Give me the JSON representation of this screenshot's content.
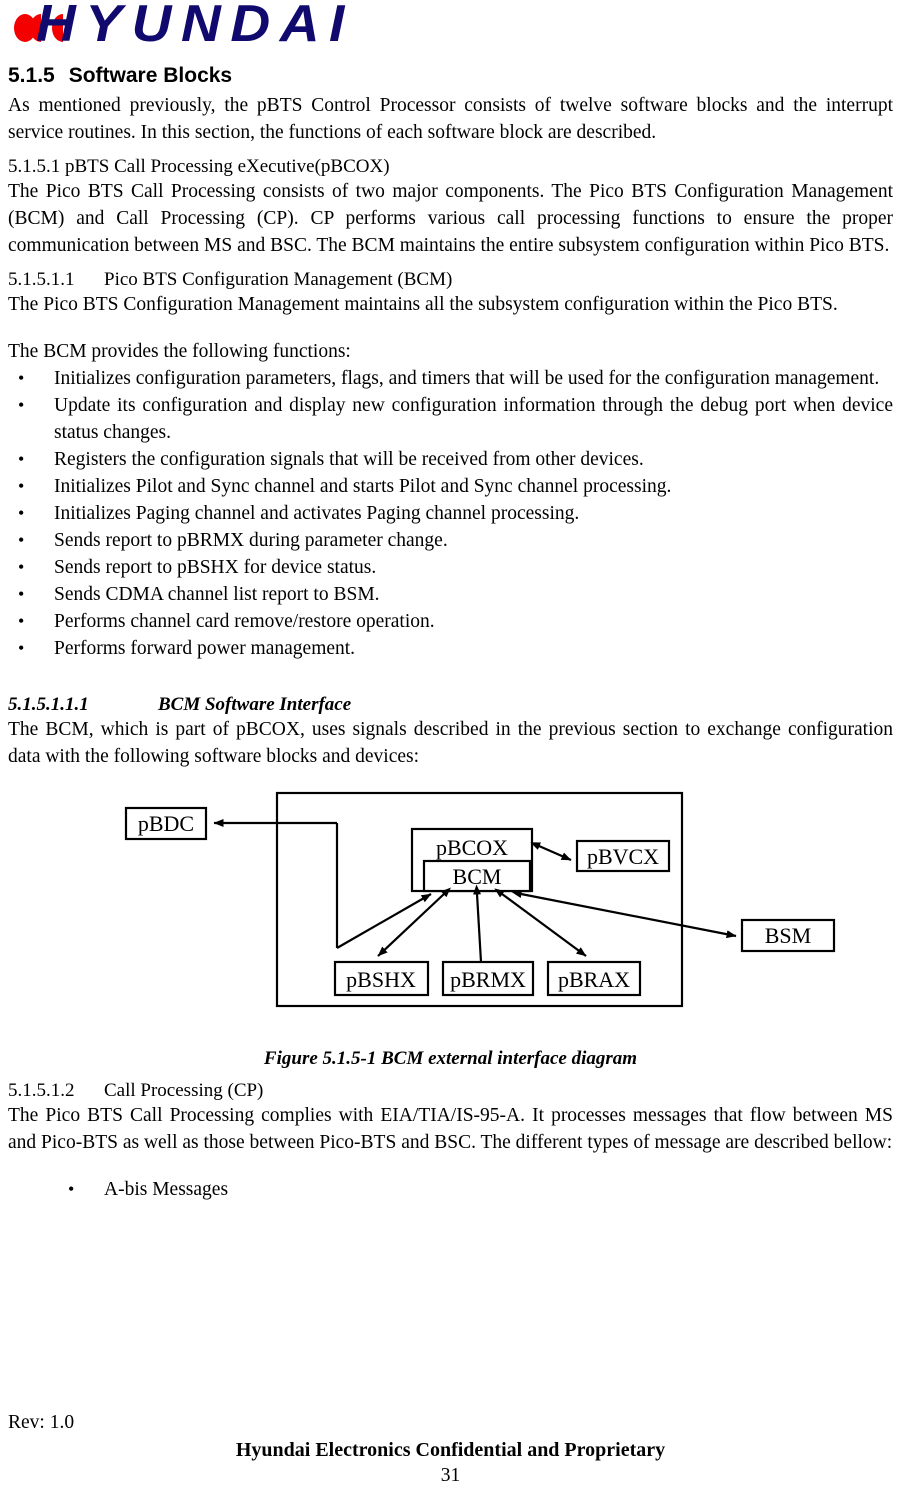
{
  "logo": {
    "wordmark": "HYUNDAI",
    "dot_color": "#f40000",
    "word_color": "#110a6e"
  },
  "headings": {
    "h1_number": "5.1.5",
    "h1_title": "Software Blocks",
    "h2_5151": "5.1.5.1  pBTS Call Processing eXecutive(pBCOX)",
    "h3_51511_num": "5.1.5.1.1",
    "h3_51511_title": "Pico BTS Configuration Management (BCM)",
    "h4_515111_num": "5.1.5.1.1.1",
    "h4_515111_title": "BCM Software Interface",
    "h3_51512_num": "5.1.5.1.2",
    "h3_51512_title": "Call Processing (CP)"
  },
  "paragraphs": {
    "intro": "As mentioned previously, the pBTS Control Processor consists of twelve software blocks and the interrupt service routines.  In this section, the functions of each software block are described.",
    "pbcox": "The Pico BTS Call Processing consists of two major components. The Pico BTS Configuration Management (BCM) and Call Processing (CP).  CP performs various call processing functions to ensure the proper communication between MS and BSC.  The BCM maintains the entire subsystem configuration within Pico BTS.",
    "bcm_intro": "The Pico BTS Configuration Management maintains all the subsystem configuration within the Pico BTS.",
    "bcm_functions_lead": "The BCM provides the following functions:",
    "bcm_sw_interface": "The BCM, which is part of pBCOX, uses signals described in the previous section to exchange configuration data with the following software blocks and devices:",
    "cp": "The Pico BTS Call Processing complies with EIA/TIA/IS-95-A.  It processes messages that flow between  MS and Pico-BTS as well as those between Pico-BTS and BSC. The different types of message are described bellow:"
  },
  "bcm_functions": [
    "Initializes configuration parameters, flags, and timers that will be used for the configuration management.",
    "Update its configuration and display new configuration information through the debug port when device status changes.",
    "Registers the configuration signals that will be received from other devices.",
    "Initializes Pilot and Sync channel and starts Pilot and Sync channel processing.",
    "Initializes Paging channel and activates Paging channel processing.",
    "Sends report to pBRMX during parameter change.",
    "Sends report to pBSHX for device status.",
    "Sends CDMA channel list report to BSM.",
    "Performs channel card remove/restore operation.",
    "Performs forward power management."
  ],
  "cp_messages": [
    "A-bis Messages"
  ],
  "figure": {
    "caption": "Figure 5.1.5-1 BCM external interface diagram",
    "nodes": {
      "pbdc": "pBDC",
      "pbcox": "pBCOX",
      "bcm": "BCM",
      "pbvcx": "pBVCX",
      "bsm": "BSM",
      "pbshx": "pBSHX",
      "pbrmx": "pBRMX",
      "pbrax": "pBRAX"
    },
    "line_color": "#000000"
  },
  "footer": {
    "rev": "Rev: 1.0",
    "confidential": "Hyundai Electronics Confidential and Proprietary",
    "page_number": "31"
  }
}
